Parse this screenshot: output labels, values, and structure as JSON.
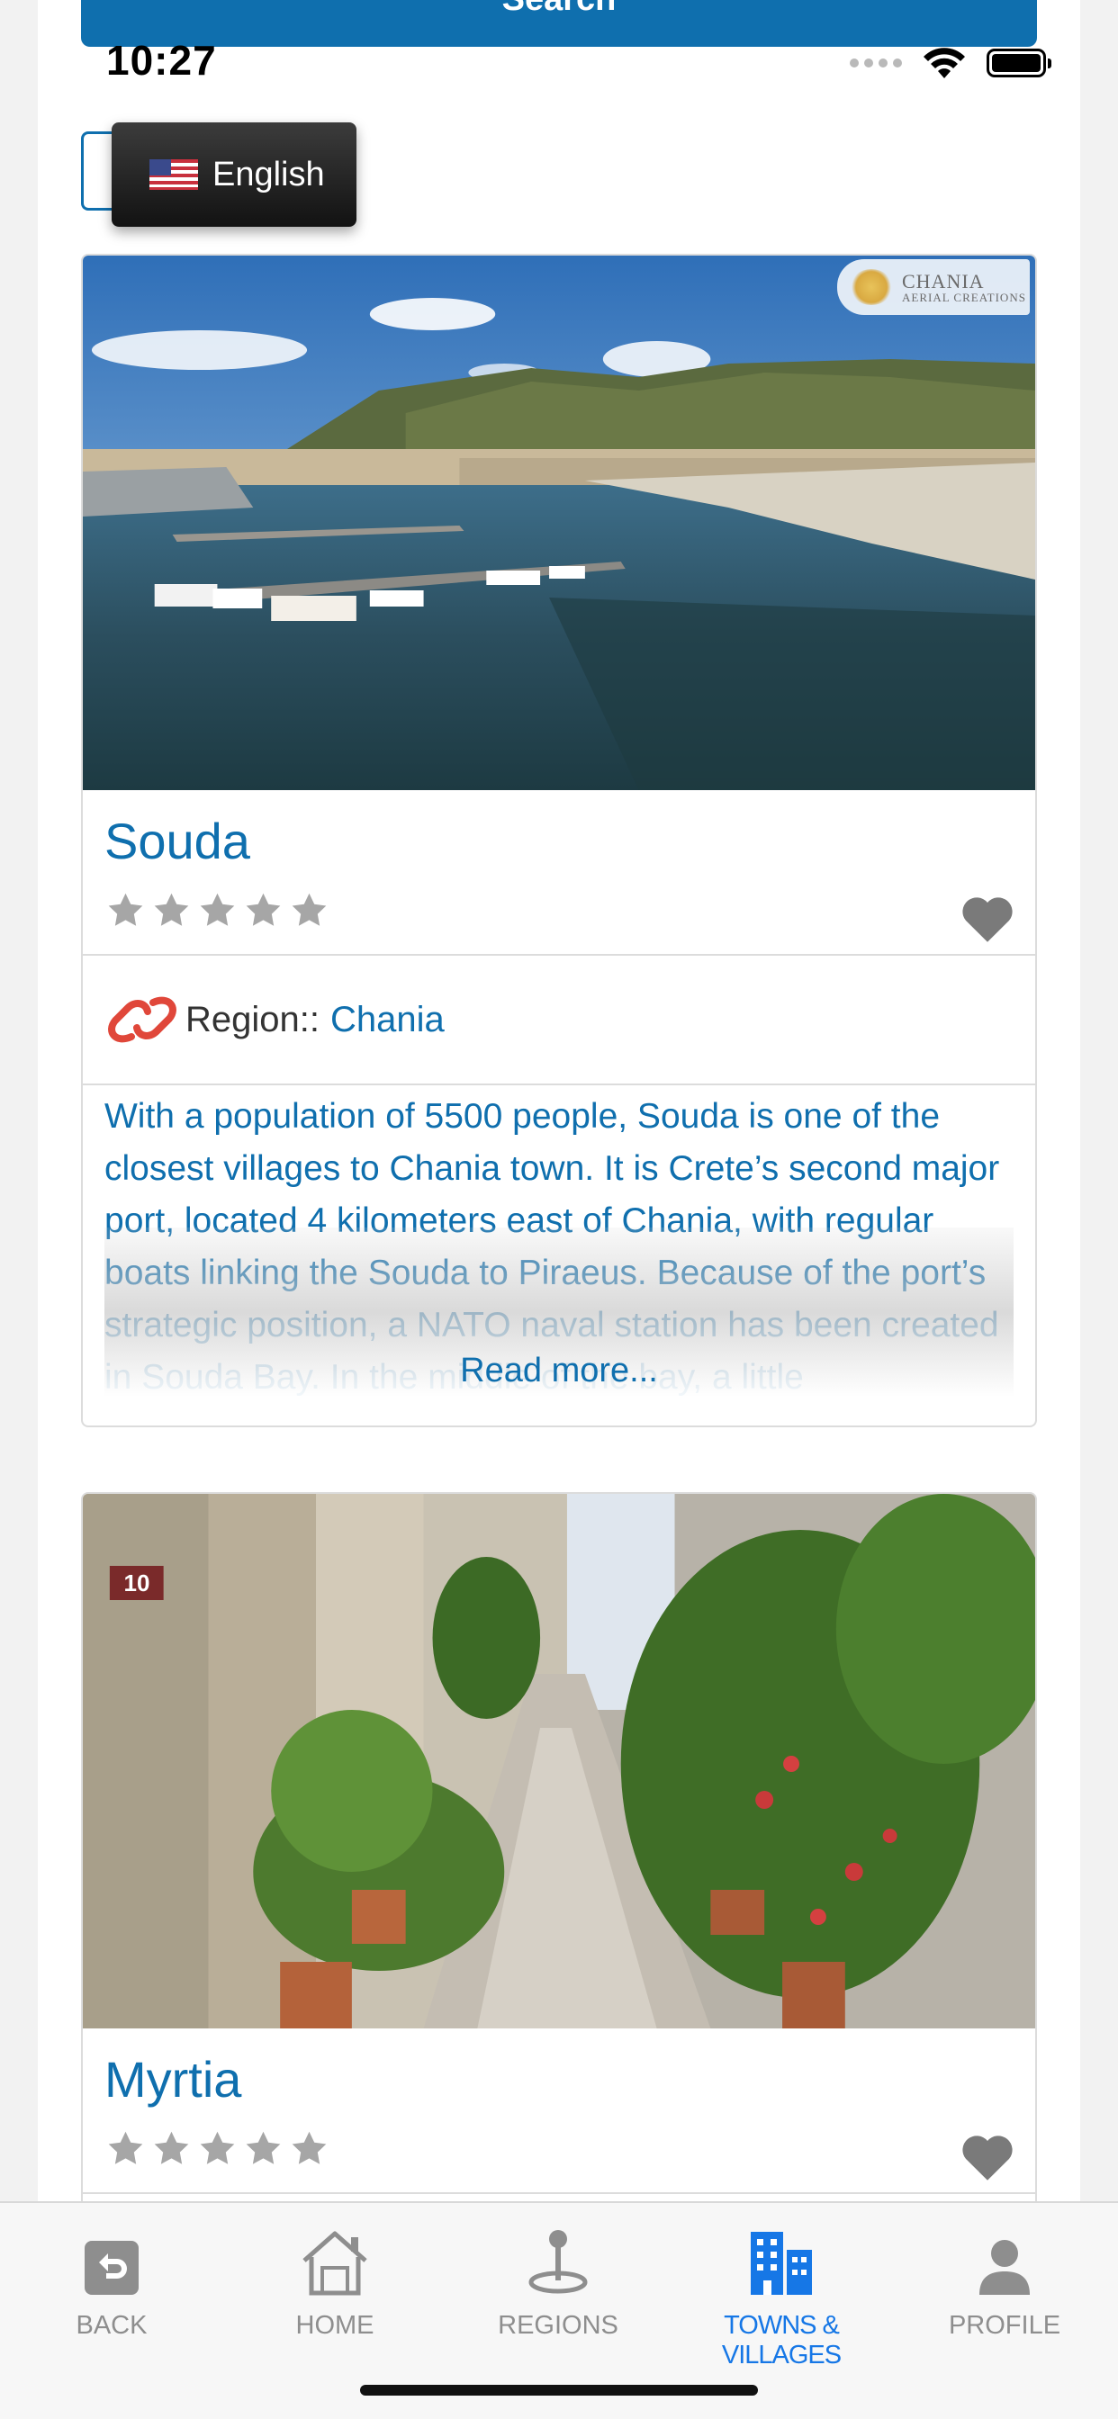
{
  "status_bar": {
    "time": "10:27"
  },
  "search_button": {
    "label": "Search"
  },
  "language_selector": {
    "label": "English",
    "flag": "us-flag-icon"
  },
  "cards": [
    {
      "title": "Souda",
      "rating": 0,
      "rating_max": 5,
      "region_label": "Region::",
      "region_value": "Chania",
      "watermark": {
        "line1": "CHANIA",
        "line2": "AERIAL CREATIONS"
      },
      "description": "With a population of 5500 people, Souda is one of the closest villages to Chania town. It is Crete’s second major port, located 4 kilometers east of Chania, with regular boats linking the Souda to Piraeus. Because of the port’s strategic position, a NATO naval station has been created in Souda Bay. In the middle of the bay, a little",
      "read_more": "Read more..."
    },
    {
      "title": "Myrtia",
      "rating": 0,
      "rating_max": 5,
      "house_number": "10"
    }
  ],
  "tab_bar": {
    "tabs": [
      {
        "label": "BACK",
        "icon": "back-arrow-icon"
      },
      {
        "label": "HOME",
        "icon": "home-icon"
      },
      {
        "label": "REGIONS",
        "icon": "map-pin-icon"
      },
      {
        "label": "TOWNS & VILLAGES",
        "icon": "buildings-icon",
        "active": true
      },
      {
        "label": "PROFILE",
        "icon": "profile-icon"
      }
    ]
  },
  "colors": {
    "brand_blue": "#0f6fae",
    "active_tab": "#1677e6",
    "star_gray": "#a6a6a6",
    "chain_red": "#e0473a"
  }
}
